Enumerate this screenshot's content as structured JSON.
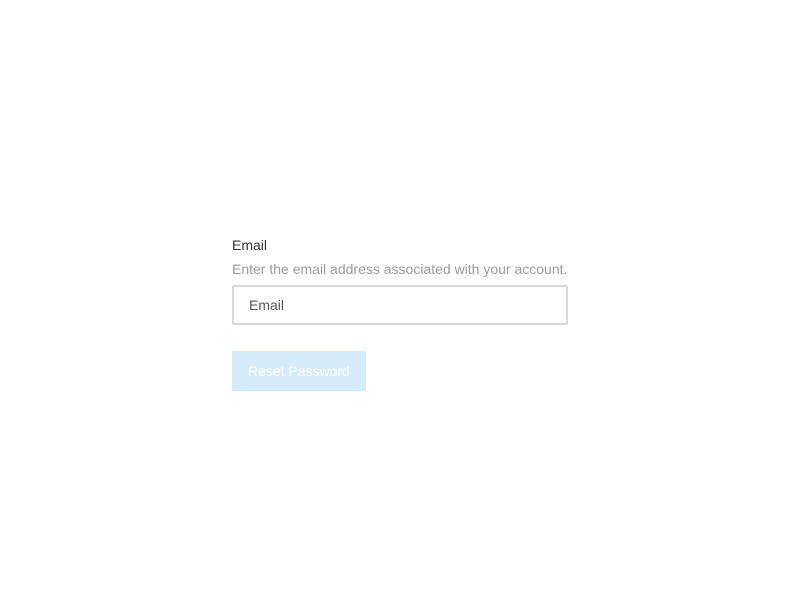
{
  "form": {
    "email_label": "Email",
    "email_hint": "Enter the email address associated with your account.",
    "email_value": "",
    "email_placeholder": "Email",
    "submit_label": "Reset Password"
  },
  "colors": {
    "background": "#ffffff",
    "label": "#333333",
    "hint": "#9a9a9a",
    "input_border": "#d8d8d8",
    "button_bg_disabled": "#d7ecfb",
    "button_text": "#ffffff"
  }
}
